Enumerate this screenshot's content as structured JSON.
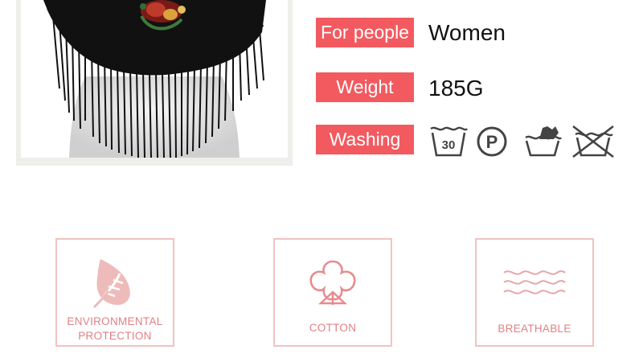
{
  "specs": {
    "for_people": {
      "label": "For people",
      "value": "Women"
    },
    "weight": {
      "label": "Weight",
      "value": "185G"
    },
    "washing": {
      "label": "Washing",
      "icons": [
        "wash-30-icon",
        "dry-clean-p-icon",
        "hand-wash-icon",
        "do-not-wash-icon"
      ],
      "wash_temp": "30",
      "dry_clean_letter": "P"
    }
  },
  "features": [
    {
      "icon": "leaf-icon",
      "line1": "ENVIRONMENTAL",
      "line2": "PROTECTION"
    },
    {
      "icon": "cotton-icon",
      "line1": "COTTON"
    },
    {
      "icon": "waves-icon",
      "line1": "BREATHABLE"
    }
  ],
  "colors": {
    "accent": "#f25a60",
    "feature_border": "#f2c2c2",
    "feature_text": "#e27f84",
    "shawl": "#111111"
  }
}
